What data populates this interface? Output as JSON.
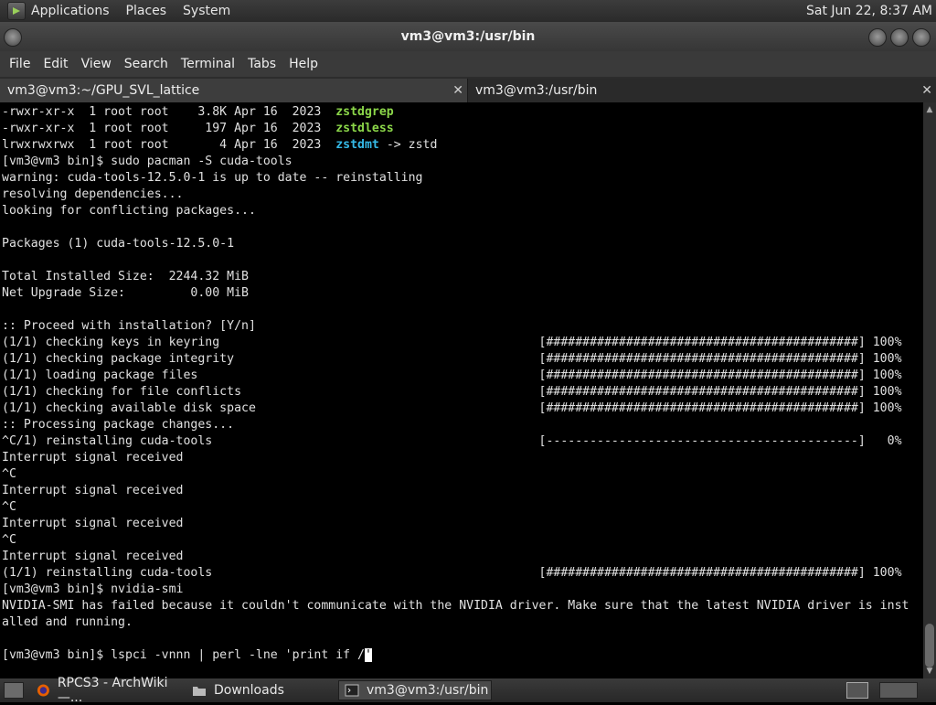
{
  "top_panel": {
    "menus": [
      "Applications",
      "Places",
      "System"
    ],
    "clock": "Sat Jun 22,  8:37 AM"
  },
  "window": {
    "title": "vm3@vm3:/usr/bin"
  },
  "menubar": [
    "File",
    "Edit",
    "View",
    "Search",
    "Terminal",
    "Tabs",
    "Help"
  ],
  "tabs": [
    {
      "label": "vm3@vm3:~/GPU_SVL_lattice",
      "close": "✕"
    },
    {
      "label": "vm3@vm3:/usr/bin",
      "close": "✕"
    }
  ],
  "terminal": {
    "lines": [
      [
        {
          "t": "-rwxr-xr-x  1 root root    3.8K Apr 16  2023  "
        },
        {
          "t": "zstdgrep",
          "c": "g"
        }
      ],
      [
        {
          "t": "-rwxr-xr-x  1 root root     197 Apr 16  2023  "
        },
        {
          "t": "zstdless",
          "c": "g"
        }
      ],
      [
        {
          "t": "lrwxrwxrwx  1 root root       4 Apr 16  2023  "
        },
        {
          "t": "zstdmt",
          "c": "c"
        },
        {
          "t": " -> zstd"
        }
      ],
      [
        {
          "t": "[vm3@vm3 bin]$ sudo pacman -S cuda-tools"
        }
      ],
      [
        {
          "t": "warning: cuda-tools-12.5.0-1 is up to date -- reinstalling"
        }
      ],
      [
        {
          "t": "resolving dependencies..."
        }
      ],
      [
        {
          "t": "looking for conflicting packages..."
        }
      ],
      [
        {
          "t": ""
        }
      ],
      [
        {
          "t": "Packages (1) cuda-tools-12.5.0-1"
        }
      ],
      [
        {
          "t": ""
        }
      ],
      [
        {
          "t": "Total Installed Size:  2244.32 MiB"
        }
      ],
      [
        {
          "t": "Net Upgrade Size:         0.00 MiB"
        }
      ],
      [
        {
          "t": ""
        }
      ],
      [
        {
          "t": ":: Proceed with installation? [Y/n]"
        }
      ],
      [
        {
          "t": "(1/1) checking keys in keyring                                            [###########################################] 100%"
        }
      ],
      [
        {
          "t": "(1/1) checking package integrity                                          [###########################################] 100%"
        }
      ],
      [
        {
          "t": "(1/1) loading package files                                               [###########################################] 100%"
        }
      ],
      [
        {
          "t": "(1/1) checking for file conflicts                                         [###########################################] 100%"
        }
      ],
      [
        {
          "t": "(1/1) checking available disk space                                       [###########################################] 100%"
        }
      ],
      [
        {
          "t": ":: Processing package changes..."
        }
      ],
      [
        {
          "t": "^C/1) reinstalling cuda-tools                                             [-------------------------------------------]   0%"
        }
      ],
      [
        {
          "t": "Interrupt signal received"
        }
      ],
      [
        {
          "t": "^C"
        }
      ],
      [
        {
          "t": "Interrupt signal received"
        }
      ],
      [
        {
          "t": "^C"
        }
      ],
      [
        {
          "t": "Interrupt signal received"
        }
      ],
      [
        {
          "t": "^C"
        }
      ],
      [
        {
          "t": "Interrupt signal received"
        }
      ],
      [
        {
          "t": "(1/1) reinstalling cuda-tools                                             [###########################################] 100%"
        }
      ],
      [
        {
          "t": "[vm3@vm3 bin]$ nvidia-smi"
        }
      ],
      [
        {
          "t": "NVIDIA-SMI has failed because it couldn't communicate with the NVIDIA driver. Make sure that the latest NVIDIA driver is inst"
        }
      ],
      [
        {
          "t": "alled and running."
        }
      ],
      [
        {
          "t": ""
        }
      ],
      [
        {
          "t": "[vm3@vm3 bin]$ lspci -vnnn | perl -lne 'print if /"
        },
        {
          "t": "'",
          "c": "cursor"
        }
      ]
    ]
  },
  "taskbar": {
    "items": [
      {
        "label": "RPCS3 - ArchWiki —...",
        "icon": "firefox-icon"
      },
      {
        "label": "Downloads",
        "icon": "folder-icon"
      },
      {
        "label": "vm3@vm3:/usr/bin",
        "icon": "terminal-icon"
      }
    ]
  },
  "colors": {
    "terminal_bg": "#000000",
    "terminal_fg": "#e0e0e0",
    "executable_green": "#8bd649",
    "symlink_cyan": "#35b9e6"
  }
}
